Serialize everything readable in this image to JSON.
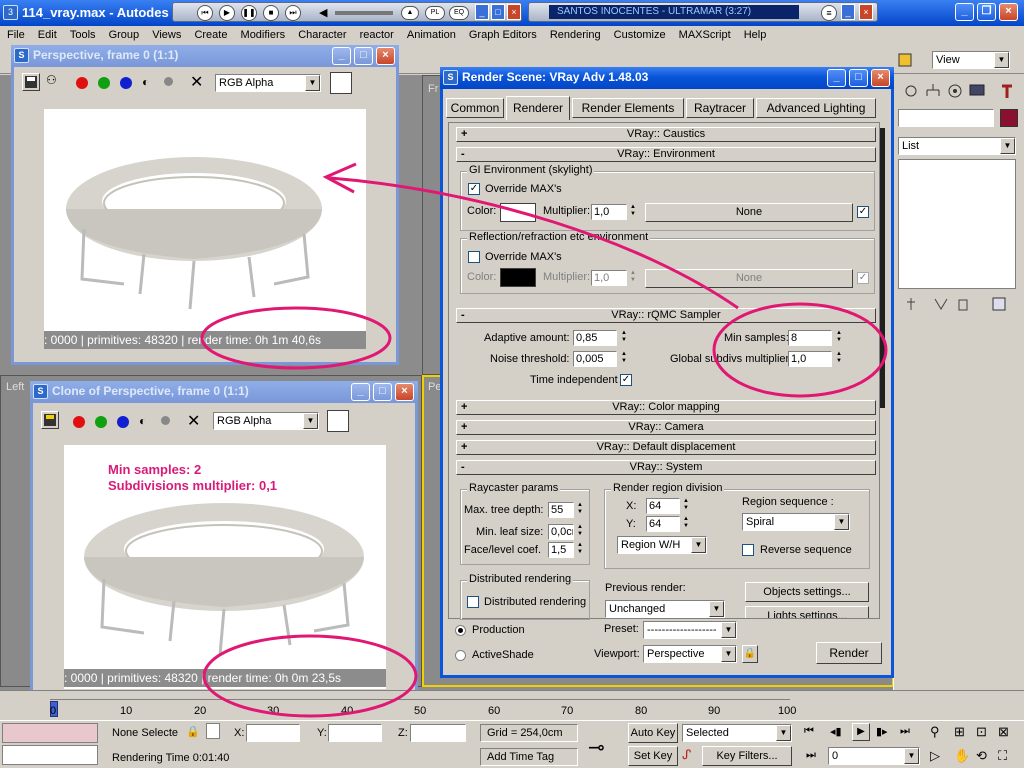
{
  "taskbar": {
    "max_title": "114_vray.max - Autodes",
    "media_track": "SANTOS INOCENTES - ULTRAMAR (3:27)"
  },
  "menubar": [
    "File",
    "Edit",
    "Tools",
    "Group",
    "Views",
    "Create",
    "Modifiers",
    "Character",
    "reactor",
    "Animation",
    "Graph Editors",
    "Rendering",
    "Customize",
    "MAXScript",
    "Help"
  ],
  "right_panel": {
    "view_combo": "View",
    "list_combo": "List"
  },
  "frame_window_1": {
    "title": "Perspective, frame 0 (1:1)",
    "channel": "RGB Alpha",
    "status": ": 0000 | primitives: 48320 | render time: 0h 1m 40,6s"
  },
  "frame_window_2": {
    "title": "Clone of Perspective, frame 0 (1:1)",
    "channel": "RGB Alpha",
    "status": ": 0000 | primitives: 48320 | render time: 0h 0m 23,5s",
    "annotation_line1": "Min samples: 2",
    "annotation_line2": "Subdivisions multiplier: 0,1"
  },
  "viewport_labels": {
    "left": "Left",
    "persp": "Pe",
    "front": "Fr"
  },
  "render_dialog": {
    "title": "Render Scene: VRay Adv 1.48.03",
    "tabs": [
      "Common",
      "Renderer",
      "Render Elements",
      "Raytracer",
      "Advanced Lighting"
    ],
    "caustics": "VRay:: Caustics",
    "environment": "VRay:: Environment",
    "gi_env_group": "GI Environment (skylight)",
    "override_max": "Override MAX's",
    "color_label": "Color:",
    "multiplier_label": "Multiplier:",
    "gi_multiplier": "1,0",
    "none_label": "None",
    "refl_group": "Reflection/refraction etc environment",
    "refl_multiplier": "1,0",
    "rqmc": "VRay:: rQMC Sampler",
    "adaptive_amount_label": "Adaptive amount:",
    "adaptive_amount": "0,85",
    "noise_threshold_label": "Noise threshold:",
    "noise_threshold": "0,005",
    "time_independent_label": "Time independent",
    "min_samples_label": "Min samples:",
    "min_samples": "8",
    "global_subdivs_label": "Global subdivs multiplier:",
    "global_subdivs": "1,0",
    "color_mapping": "VRay:: Color mapping",
    "camera": "VRay:: Camera",
    "default_displacement": "VRay:: Default displacement",
    "system": "VRay:: System",
    "raycaster_group": "Raycaster params",
    "max_tree_depth_label": "Max. tree depth:",
    "max_tree_depth": "55",
    "min_leaf_label": "Min. leaf size:",
    "min_leaf": "0,0cr",
    "face_level_label": "Face/level coef.",
    "face_level": "1,5",
    "render_region_group": "Render region division",
    "x_label": "X:",
    "x_value": "64",
    "y_label": "Y:",
    "y_value": "64",
    "region_wh": "Region W/H",
    "region_sequence_label": "Region sequence :",
    "region_sequence": "Spiral",
    "reverse_sequence": "Reverse sequence",
    "distributed_group": "Distributed rendering",
    "distributed_check": "Distributed rendering",
    "previous_render_label": "Previous render:",
    "previous_render": "Unchanged",
    "objects_settings": "Objects settings...",
    "lights_settings": "Lights settings...",
    "production": "Production",
    "activeshade": "ActiveShade",
    "preset_label": "Preset:",
    "preset_value": "-------------------",
    "viewport_label": "Viewport:",
    "viewport_value": "Perspective",
    "render_button": "Render"
  },
  "timeline": {
    "ticks": [
      "0",
      "10",
      "20",
      "30",
      "40",
      "50",
      "60",
      "70",
      "80",
      "90",
      "100"
    ]
  },
  "statusbar": {
    "selection": "None Selecte",
    "x_label": "X:",
    "y_label": "Y:",
    "z_label": "Z:",
    "grid": "Grid = 254,0cm",
    "rendering_time": "Rendering Time  0:01:40",
    "add_time_tag": "Add Time Tag",
    "auto_key": "Auto Key",
    "set_key": "Set Key",
    "selected": "Selected",
    "key_filters": "Key Filters...",
    "frame": "0"
  },
  "colors": {
    "annotation": "#e01874",
    "xp_blue": "#0a55d8"
  }
}
